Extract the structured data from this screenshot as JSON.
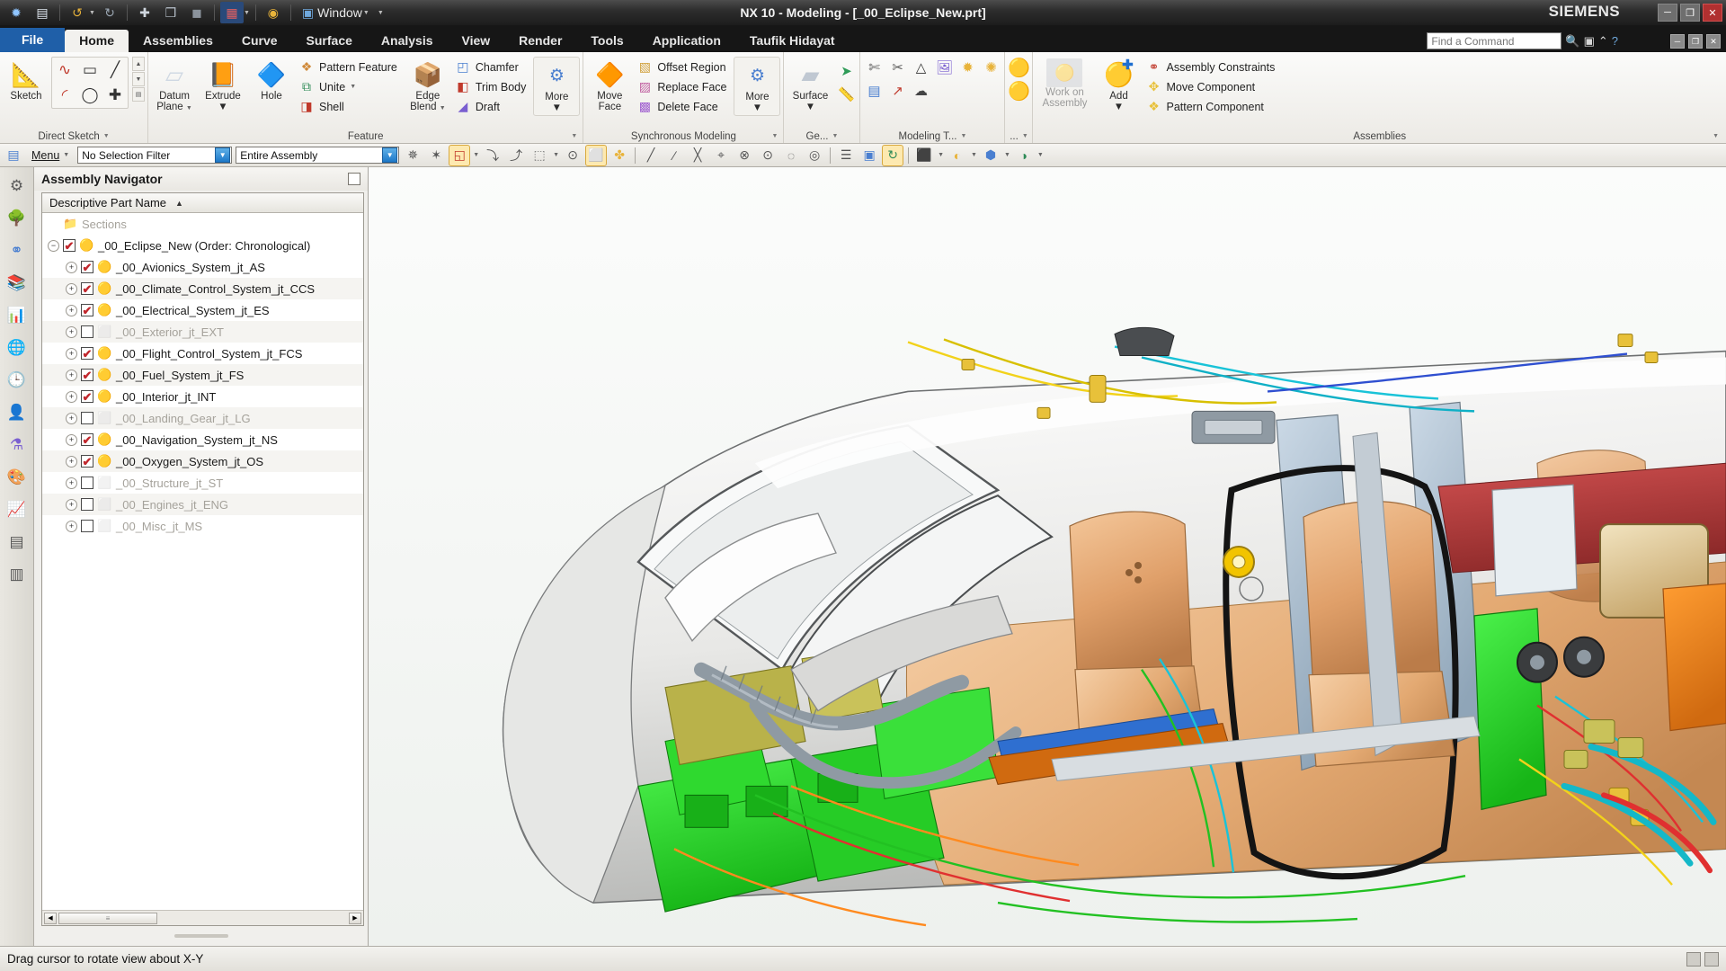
{
  "window": {
    "title": "NX 10 - Modeling - [_00_Eclipse_New.prt]",
    "brand": "SIEMENS",
    "quick_access": [
      {
        "name": "nx-logo-icon",
        "glyph": "❈"
      },
      {
        "name": "save-icon",
        "glyph": "💾"
      },
      {
        "name": "undo-icon",
        "glyph": "↶"
      },
      {
        "name": "redo-icon",
        "glyph": "↷"
      },
      {
        "name": "cut-icon",
        "glyph": "✂"
      },
      {
        "name": "copy-icon",
        "glyph": "❐"
      },
      {
        "name": "paste-icon",
        "glyph": "▣"
      },
      {
        "name": "window-grid-icon",
        "glyph": "▦"
      },
      {
        "name": "view-icon",
        "glyph": "◉"
      }
    ],
    "window_menu_label": "Window",
    "controls": {
      "minimize": "─",
      "restore": "❐",
      "close": "✕"
    }
  },
  "tabs": [
    {
      "label": "File",
      "state": "file"
    },
    {
      "label": "Home",
      "state": "active"
    },
    {
      "label": "Assemblies",
      "state": "normal"
    },
    {
      "label": "Curve",
      "state": "normal"
    },
    {
      "label": "Surface",
      "state": "normal"
    },
    {
      "label": "Analysis",
      "state": "normal"
    },
    {
      "label": "View",
      "state": "normal"
    },
    {
      "label": "Render",
      "state": "normal"
    },
    {
      "label": "Tools",
      "state": "normal"
    },
    {
      "label": "Application",
      "state": "normal"
    },
    {
      "label": "Taufik Hidayat",
      "state": "normal"
    }
  ],
  "find": {
    "placeholder": "Find a Command",
    "search_icon": "search-icon",
    "help_icon": "help-icon",
    "chevron_icon": "chevron-up-icon"
  },
  "ribbon": {
    "groups": [
      {
        "label": "Direct Sketch",
        "has_dialog_launcher": true,
        "big_buttons": [
          {
            "label": "Sketch",
            "label2": "",
            "glyph": "📐",
            "icon": "sketch-icon",
            "dropdown": false,
            "disabled": false
          }
        ],
        "sketch_grid": [
          {
            "name": "profile-icon",
            "glyph": "∿"
          },
          {
            "name": "rectangle-icon",
            "glyph": "▭"
          },
          {
            "name": "line-icon",
            "glyph": "╱"
          },
          {
            "name": "arc-icon",
            "glyph": "◜"
          },
          {
            "name": "circle-icon",
            "glyph": "◯"
          },
          {
            "name": "point-icon",
            "glyph": "✚"
          }
        ]
      },
      {
        "label": "Feature",
        "has_dialog_launcher": true,
        "big_buttons": [
          {
            "label": "Datum",
            "label2": "Plane",
            "glyph": "▱",
            "icon": "datum-plane-icon",
            "dropdown": true,
            "disabled": false
          },
          {
            "label": "Extrude",
            "label2": "",
            "glyph": "📙",
            "icon": "extrude-icon",
            "dropdown": true,
            "disabled": false
          },
          {
            "label": "Hole",
            "label2": "",
            "glyph": "🔷",
            "icon": "hole-icon",
            "dropdown": false,
            "disabled": false
          }
        ],
        "small_buttons": [
          {
            "label": "Pattern Feature",
            "glyph": "❖",
            "icon": "pattern-feature-icon",
            "dropdown": false
          },
          {
            "label": "Unite",
            "glyph": "⧉",
            "icon": "unite-icon",
            "dropdown": true
          },
          {
            "label": "Shell",
            "glyph": "◨",
            "icon": "shell-icon",
            "dropdown": false
          }
        ],
        "big_buttons2": [
          {
            "label": "Edge",
            "label2": "Blend",
            "glyph": "📦",
            "icon": "edge-blend-icon",
            "dropdown": true,
            "disabled": false
          }
        ],
        "small_buttons2": [
          {
            "label": "Chamfer",
            "glyph": "◰",
            "icon": "chamfer-icon",
            "dropdown": false
          },
          {
            "label": "Trim Body",
            "glyph": "◧",
            "icon": "trim-body-icon",
            "dropdown": false
          },
          {
            "label": "Draft",
            "glyph": "◢",
            "icon": "draft-icon",
            "dropdown": false
          }
        ],
        "more": {
          "label": "More",
          "glyph": "⚙",
          "icon": "more-feature-icon",
          "dropdown": true
        }
      },
      {
        "label": "Synchronous Modeling",
        "has_dialog_launcher": true,
        "big_buttons": [
          {
            "label": "Move",
            "label2": "Face",
            "glyph": "🔶",
            "icon": "move-face-icon",
            "dropdown": false,
            "disabled": false
          }
        ],
        "small_buttons": [
          {
            "label": "Offset Region",
            "glyph": "▧",
            "icon": "offset-region-icon"
          },
          {
            "label": "Replace Face",
            "glyph": "▨",
            "icon": "replace-face-icon"
          },
          {
            "label": "Delete Face",
            "glyph": "▩",
            "icon": "delete-face-icon"
          }
        ],
        "more": {
          "label": "More",
          "glyph": "⚙",
          "icon": "more-synchronous-icon",
          "dropdown": true
        }
      },
      {
        "label": "Ge...",
        "has_dialog_launcher": true,
        "big_buttons": [
          {
            "label": "Surface",
            "label2": "",
            "glyph": "▰",
            "icon": "surface-icon",
            "dropdown": true,
            "disabled": false
          }
        ],
        "icons": [
          {
            "name": "through-curves-icon",
            "glyph": "⬚"
          },
          {
            "name": "measure-icon",
            "glyph": "📏"
          }
        ]
      },
      {
        "label": "Modeling T...",
        "has_dialog_launcher": true,
        "icon_rows": [
          [
            {
              "name": "wave-geometry-icon",
              "glyph": "✄"
            },
            {
              "name": "wave-link-icon",
              "glyph": "✂"
            }
          ],
          [
            {
              "name": "deform-icon",
              "glyph": "△"
            },
            {
              "name": "pmi-icon",
              "glyph": "🖼"
            },
            {
              "name": "assembly-cut-icon",
              "glyph": "✹"
            },
            {
              "name": "assembly-tool-icon",
              "glyph": "❀"
            }
          ]
        ],
        "icon_rows2": [
          [
            {
              "name": "note-icon",
              "glyph": "▤"
            },
            {
              "name": "datum-axis-icon",
              "glyph": "↗"
            },
            {
              "name": "weld-icon",
              "glyph": "☁"
            }
          ]
        ]
      },
      {
        "label": "...",
        "has_dialog_launcher": true,
        "icons": [
          {
            "name": "assembly-component-icon",
            "glyph": "🟡"
          },
          {
            "name": "assembly-component2-icon",
            "glyph": "🟡"
          }
        ]
      },
      {
        "label": "Assemblies",
        "has_dialog_launcher": true,
        "big_buttons": [
          {
            "label": "Work on",
            "label2": "Assembly",
            "glyph": "🟡",
            "icon": "work-on-assembly-icon",
            "dropdown": false,
            "disabled": true
          },
          {
            "label": "Add",
            "label2": "",
            "glyph": "🟡",
            "icon": "add-component-icon",
            "dropdown": true,
            "disabled": false
          }
        ],
        "small_buttons": [
          {
            "label": "Assembly Constraints",
            "glyph": "⚭",
            "icon": "assembly-constraints-icon"
          },
          {
            "label": "Move Component",
            "glyph": "✥",
            "icon": "move-component-icon"
          },
          {
            "label": "Pattern Component",
            "glyph": "❖",
            "icon": "pattern-component-icon"
          }
        ]
      }
    ]
  },
  "selection_toolbar": {
    "menu_label": "Menu",
    "menu_icon": "menu-icon",
    "selection_filter": {
      "value": "No Selection Filter",
      "name": "selection-filter-dropdown"
    },
    "scope": {
      "value": "Entire Assembly",
      "name": "selection-scope-dropdown"
    },
    "icons": [
      {
        "name": "select-general-objects-icon",
        "glyph": "✵"
      },
      {
        "name": "select-feature-icon",
        "glyph": "✶"
      },
      {
        "name": "select-face-icon",
        "glyph": "◱"
      },
      {
        "name": "select-edge-icon",
        "glyph": "⤵"
      },
      {
        "name": "select-curve-icon",
        "glyph": "⤴"
      },
      {
        "name": "rectangle-select-icon",
        "glyph": "⬚"
      },
      {
        "name": "snap-point-icon",
        "glyph": "⊙"
      },
      {
        "name": "shaded-view-icon",
        "glyph": "⬜"
      },
      {
        "name": "orient-view-icon",
        "glyph": "✤"
      },
      {
        "name": "endpoint-snap-icon",
        "glyph": "╱"
      },
      {
        "name": "midpoint-snap-icon",
        "glyph": "∕"
      },
      {
        "name": "intersection-snap-icon",
        "glyph": "╳"
      },
      {
        "name": "arc-center-snap-icon",
        "glyph": "⌖"
      },
      {
        "name": "quadrant-snap-icon",
        "glyph": "⊗"
      },
      {
        "name": "existing-point-snap-icon",
        "glyph": "⊙"
      },
      {
        "name": "point-on-curve-icon",
        "glyph": "◌"
      },
      {
        "name": "point-on-face-icon",
        "glyph": "◎"
      },
      {
        "name": "layer-settings-icon",
        "glyph": "☰"
      },
      {
        "name": "layer-visible-icon",
        "glyph": "▣"
      },
      {
        "name": "move-to-layer-icon",
        "glyph": "↻"
      },
      {
        "name": "work-view-icon",
        "glyph": "⬛"
      },
      {
        "name": "render-style-icon",
        "glyph": "◐"
      },
      {
        "name": "background-icon",
        "glyph": "⬢"
      },
      {
        "name": "true-shading-icon",
        "glyph": "◑"
      }
    ]
  },
  "resource_bar": [
    {
      "name": "resource-assembly-navigator",
      "glyph": "⚙",
      "selected": false
    },
    {
      "name": "resource-part-navigator",
      "glyph": "🌳",
      "selected": false
    },
    {
      "name": "resource-constraint-navigator",
      "glyph": "⚭",
      "selected": false
    },
    {
      "name": "resource-reuse-library",
      "glyph": "📚",
      "selected": false
    },
    {
      "name": "resource-hd3d-tools",
      "glyph": "📊",
      "selected": false
    },
    {
      "name": "resource-web-browser",
      "glyph": "🌐",
      "selected": false
    },
    {
      "name": "resource-history",
      "glyph": "🕒",
      "selected": false
    },
    {
      "name": "resource-roles",
      "glyph": "👤",
      "selected": false
    },
    {
      "name": "resource-system-materials",
      "glyph": "⚗",
      "selected": false
    },
    {
      "name": "resource-system-scenes",
      "glyph": "🎨",
      "selected": false
    },
    {
      "name": "resource-system-visual-reporting",
      "glyph": "📈",
      "selected": false
    },
    {
      "name": "resource-process-studio",
      "glyph": "▤",
      "selected": false
    },
    {
      "name": "resource-system-views",
      "glyph": "▥",
      "selected": false
    }
  ],
  "navigator": {
    "title": "Assembly Navigator",
    "pin_icon": "pin-icon",
    "column_header": "Descriptive Part Name",
    "sort_arrow": "▲",
    "scroll_thumb_label": "≡",
    "items": [
      {
        "label": "Sections",
        "type": "folder",
        "indent": 1,
        "expander": "none",
        "checked": null,
        "dim": true
      },
      {
        "label": "_00_Eclipse_New (Order: Chronological)",
        "type": "assembly",
        "indent": 1,
        "expander": "minus",
        "checked": true,
        "dim": false
      },
      {
        "label": "_00_Avionics_System_jt_AS",
        "type": "assembly",
        "indent": 2,
        "expander": "plus",
        "checked": true,
        "dim": false
      },
      {
        "label": "_00_Climate_Control_System_jt_CCS",
        "type": "assembly",
        "indent": 2,
        "expander": "plus",
        "checked": true,
        "dim": false
      },
      {
        "label": "_00_Electrical_System_jt_ES",
        "type": "assembly",
        "indent": 2,
        "expander": "plus",
        "checked": true,
        "dim": false
      },
      {
        "label": "_00_Exterior_jt_EXT",
        "type": "assembly-off",
        "indent": 2,
        "expander": "plus",
        "checked": false,
        "dim": true
      },
      {
        "label": "_00_Flight_Control_System_jt_FCS",
        "type": "assembly",
        "indent": 2,
        "expander": "plus",
        "checked": true,
        "dim": false
      },
      {
        "label": "_00_Fuel_System_jt_FS",
        "type": "assembly",
        "indent": 2,
        "expander": "plus",
        "checked": true,
        "dim": false
      },
      {
        "label": "_00_Interior_jt_INT",
        "type": "assembly",
        "indent": 2,
        "expander": "plus",
        "checked": true,
        "dim": false
      },
      {
        "label": "_00_Landing_Gear_jt_LG",
        "type": "assembly-off",
        "indent": 2,
        "expander": "plus",
        "checked": false,
        "dim": true
      },
      {
        "label": "_00_Navigation_System_jt_NS",
        "type": "assembly",
        "indent": 2,
        "expander": "plus",
        "checked": true,
        "dim": false
      },
      {
        "label": "_00_Oxygen_System_jt_OS",
        "type": "assembly",
        "indent": 2,
        "expander": "plus",
        "checked": true,
        "dim": false
      },
      {
        "label": "_00_Structure_jt_ST",
        "type": "assembly-off",
        "indent": 2,
        "expander": "plus",
        "checked": false,
        "dim": true
      },
      {
        "label": "_00_Engines_jt_ENG",
        "type": "assembly-off",
        "indent": 2,
        "expander": "plus",
        "checked": false,
        "dim": true
      },
      {
        "label": "_00_Misc_jt_MS",
        "type": "assembly-off",
        "indent": 2,
        "expander": "plus",
        "checked": false,
        "dim": true
      }
    ]
  },
  "statusbar": {
    "message": "Drag cursor to rotate view about X-Y"
  },
  "colors": {
    "accent_blue": "#1f5fa8",
    "titlebar_dark": "#1c1c1c",
    "ribbon_bg": "#eceae5",
    "check_red": "#c1272d",
    "folder_yellow": "#e8b33a"
  }
}
